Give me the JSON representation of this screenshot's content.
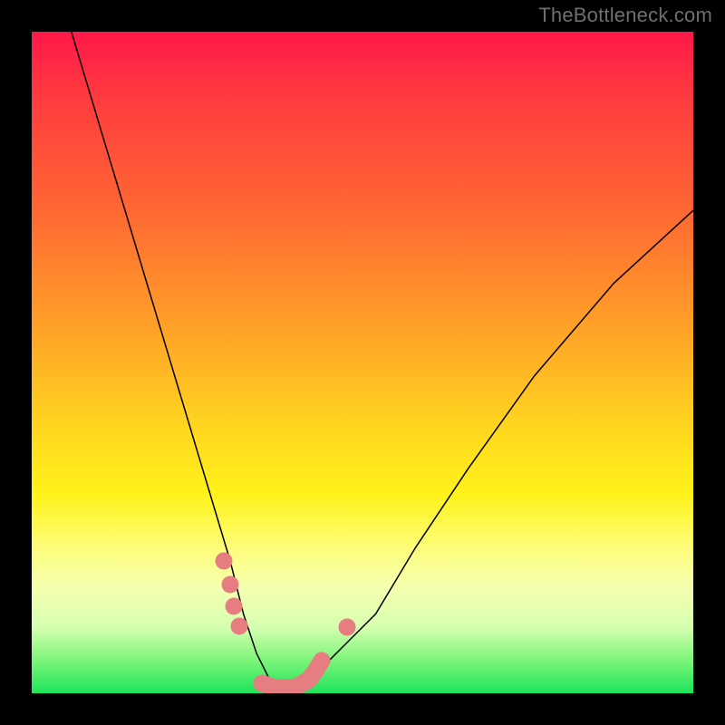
{
  "watermark": "TheBottleneck.com",
  "chart_data": {
    "type": "line",
    "title": "",
    "xlabel": "",
    "ylabel": "",
    "xlim": [
      0,
      100
    ],
    "ylim": [
      0,
      100
    ],
    "grid": false,
    "legend": false,
    "background_gradient": {
      "direction": "vertical",
      "stops": [
        {
          "pos": 0,
          "color": "#ff1849",
          "meaning": "worst"
        },
        {
          "pos": 50,
          "color": "#ffd61f",
          "meaning": "mid"
        },
        {
          "pos": 100,
          "color": "#1de45a",
          "meaning": "best"
        }
      ]
    },
    "series": [
      {
        "name": "bottleneck-curve",
        "x": [
          6,
          9,
          12,
          15,
          18,
          21,
          24,
          27,
          30,
          32,
          34,
          36,
          38,
          42,
          46,
          52,
          58,
          66,
          76,
          88,
          100
        ],
        "y": [
          100,
          90,
          80,
          70,
          60,
          50,
          40,
          30,
          20,
          12,
          6,
          2,
          0,
          2,
          6,
          12,
          22,
          34,
          48,
          62,
          73
        ],
        "color": "#000000"
      }
    ],
    "markers": {
      "name": "highlighted-points",
      "color": "#e67d80",
      "points": [
        {
          "x": 29,
          "y": 20
        },
        {
          "x": 30,
          "y": 16
        },
        {
          "x": 30.6,
          "y": 13
        },
        {
          "x": 31.4,
          "y": 10
        },
        {
          "x": 35,
          "y": 2
        },
        {
          "x": 37,
          "y": 1
        },
        {
          "x": 40,
          "y": 1
        },
        {
          "x": 42,
          "y": 2
        },
        {
          "x": 43,
          "y": 3.5
        },
        {
          "x": 44,
          "y": 5
        },
        {
          "x": 48,
          "y": 10
        }
      ]
    }
  }
}
